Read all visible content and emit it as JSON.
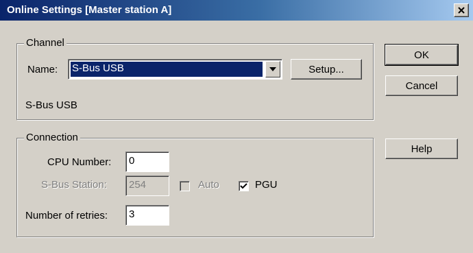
{
  "window": {
    "title": "Online Settings [Master station A]"
  },
  "channel": {
    "legend": "Channel",
    "name_label": "Name:",
    "name_value": "S-Bus USB",
    "setup_label": "Setup...",
    "info_text": "S-Bus USB"
  },
  "connection": {
    "legend": "Connection",
    "cpu_label": "CPU Number:",
    "cpu_value": "0",
    "station_label": "S-Bus Station:",
    "station_value": "254",
    "auto_label": "Auto",
    "auto_checked": false,
    "pgu_label": "PGU",
    "pgu_checked": true,
    "retries_label": "Number of retries:",
    "retries_value": "3"
  },
  "buttons": {
    "ok": "OK",
    "cancel": "Cancel",
    "help": "Help"
  },
  "icons": {
    "close": "close-icon",
    "dropdown": "chevron-down-icon",
    "check": "check-icon"
  },
  "colors": {
    "titlebar_start": "#0a246a",
    "titlebar_end": "#a6caf0",
    "face": "#d4d0c8",
    "selection": "#0a246a"
  }
}
